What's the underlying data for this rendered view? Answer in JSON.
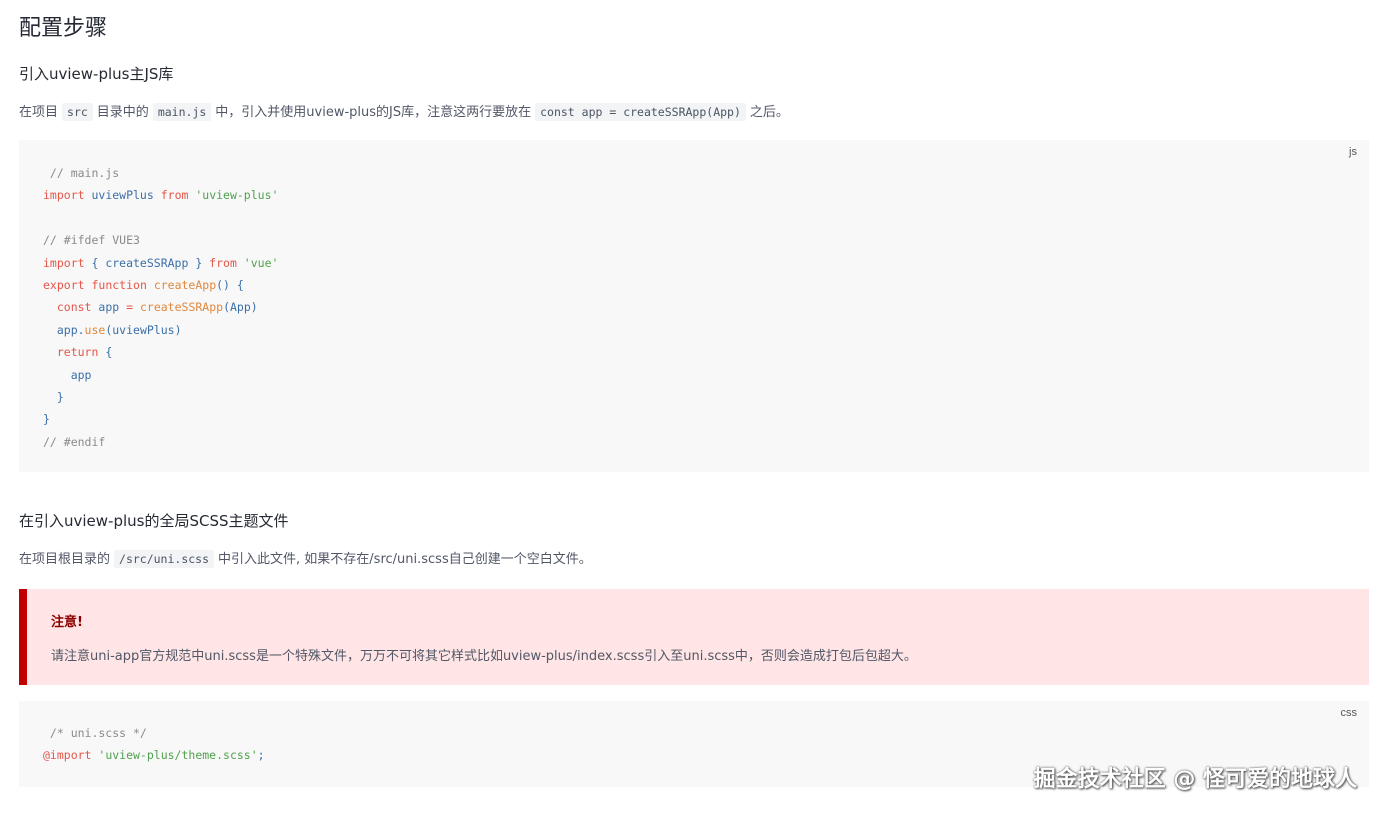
{
  "heading": "配置步骤",
  "section1": {
    "title": "引入uview-plus主JS库",
    "para": {
      "t1": "在项目",
      "c1": "src",
      "t2": "目录中的",
      "c2": "main.js",
      "t3": "中，引入并使用uview-plus的JS库，注意这两行要放在",
      "c3": "const app = createSSRApp(App)",
      "t4": "之后。"
    },
    "code": {
      "lang": "js",
      "lines": [
        [
          {
            "t": " // main.js",
            "c": "comment"
          }
        ],
        [
          {
            "t": "import",
            "c": "kw"
          },
          {
            "t": " uviewPlus ",
            "c": "id"
          },
          {
            "t": "from",
            "c": "kw"
          },
          {
            "t": " 'uview-plus'",
            "c": "str"
          }
        ],
        [],
        [
          {
            "t": "// #ifdef VUE3",
            "c": "comment"
          }
        ],
        [
          {
            "t": "import",
            "c": "kw"
          },
          {
            "t": " { createSSRApp } ",
            "c": "id"
          },
          {
            "t": "from",
            "c": "kw"
          },
          {
            "t": " 'vue'",
            "c": "str"
          }
        ],
        [
          {
            "t": "export",
            "c": "kw"
          },
          {
            "t": " ",
            "c": "id"
          },
          {
            "t": "function",
            "c": "kw"
          },
          {
            "t": " ",
            "c": "id"
          },
          {
            "t": "createApp",
            "c": "fn"
          },
          {
            "t": "() {",
            "c": "punc"
          }
        ],
        [
          {
            "t": "  ",
            "c": "id"
          },
          {
            "t": "const",
            "c": "kw"
          },
          {
            "t": " app ",
            "c": "id"
          },
          {
            "t": "=",
            "c": "kw"
          },
          {
            "t": " ",
            "c": "id"
          },
          {
            "t": "createSSRApp",
            "c": "fn"
          },
          {
            "t": "(App)",
            "c": "punc"
          }
        ],
        [
          {
            "t": "  app.",
            "c": "id"
          },
          {
            "t": "use",
            "c": "fn"
          },
          {
            "t": "(uviewPlus)",
            "c": "punc"
          }
        ],
        [
          {
            "t": "  ",
            "c": "id"
          },
          {
            "t": "return",
            "c": "kw"
          },
          {
            "t": " {",
            "c": "punc"
          }
        ],
        [
          {
            "t": "    app",
            "c": "id"
          }
        ],
        [
          {
            "t": "  }",
            "c": "punc"
          }
        ],
        [
          {
            "t": "}",
            "c": "punc"
          }
        ],
        [
          {
            "t": "// #endif",
            "c": "comment"
          }
        ]
      ]
    }
  },
  "section2": {
    "title": "在引入uview-plus的全局SCSS主题文件",
    "para": {
      "t1": "在项目根目录的",
      "c1": "/src/uni.scss",
      "t2": "中引入此文件, 如果不存在/src/uni.scss自己创建一个空白文件。"
    },
    "warning": {
      "title": "注意!",
      "text": "请注意uni-app官方规范中uni.scss是一个特殊文件，万万不可将其它样式比如uview-plus/index.scss引入至uni.scss中，否则会造成打包后包超大。"
    },
    "code": {
      "lang": "css",
      "lines": [
        [
          {
            "t": " /* uni.scss */",
            "c": "comment"
          }
        ],
        [
          {
            "t": "@import",
            "c": "kw"
          },
          {
            "t": " 'uview-plus/theme.scss'",
            "c": "str"
          },
          {
            "t": ";",
            "c": "id"
          }
        ]
      ]
    }
  },
  "watermark": "掘金技术社区 @ 怪可爱的地球人",
  "colors": {
    "keyword": "#e45649",
    "string": "#50a14f",
    "identifier": "#3b6fa8",
    "function": "#e0873b",
    "comment": "#8a8a8a",
    "warning_border": "#c00000",
    "warning_bg": "#ffe5e5"
  }
}
